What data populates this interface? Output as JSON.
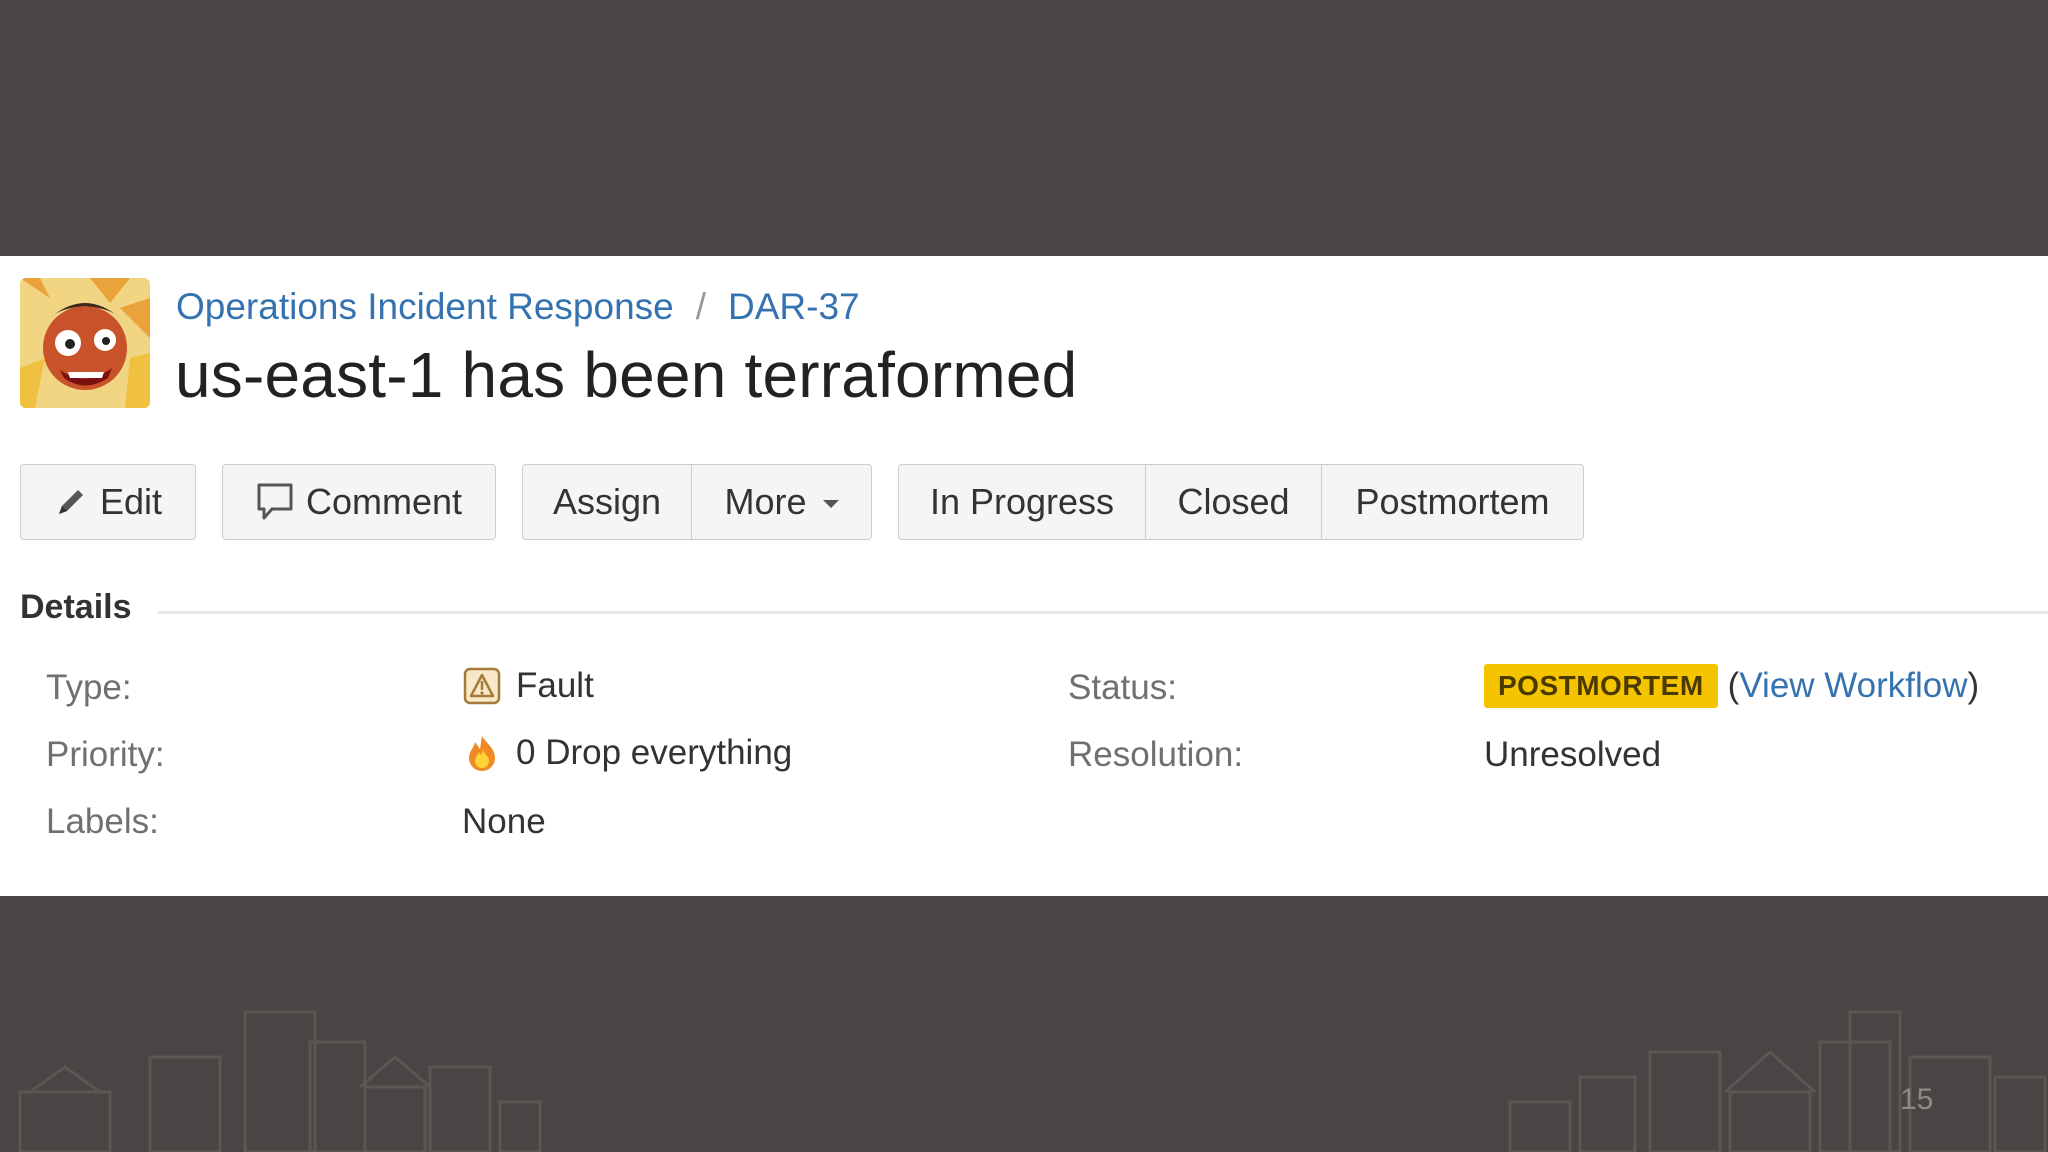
{
  "breadcrumb": {
    "project": "Operations Incident Response",
    "separator": "/",
    "issue_key": "DAR-37"
  },
  "issue": {
    "title": "us-east-1 has been terraformed"
  },
  "toolbar": {
    "edit_label": "Edit",
    "comment_label": "Comment",
    "assign_label": "Assign",
    "more_label": "More",
    "in_progress_label": "In Progress",
    "closed_label": "Closed",
    "postmortem_label": "Postmortem"
  },
  "details": {
    "heading": "Details",
    "type_label": "Type:",
    "type_value": "Fault",
    "priority_label": "Priority:",
    "priority_value": "0 Drop everything",
    "labels_label": "Labels:",
    "labels_value": "None",
    "status_label": "Status:",
    "status_value": "POSTMORTEM",
    "view_workflow": "View Workflow",
    "resolution_label": "Resolution:",
    "resolution_value": "Unresolved"
  },
  "slide": {
    "page_number": "15"
  },
  "colors": {
    "link": "#3572b0",
    "status_badge": "#f5c400",
    "background": "#4a4646"
  },
  "icons": {
    "edit": "pencil-icon",
    "comment": "speech-bubble-icon",
    "type": "fault-icon",
    "priority": "flame-icon"
  }
}
